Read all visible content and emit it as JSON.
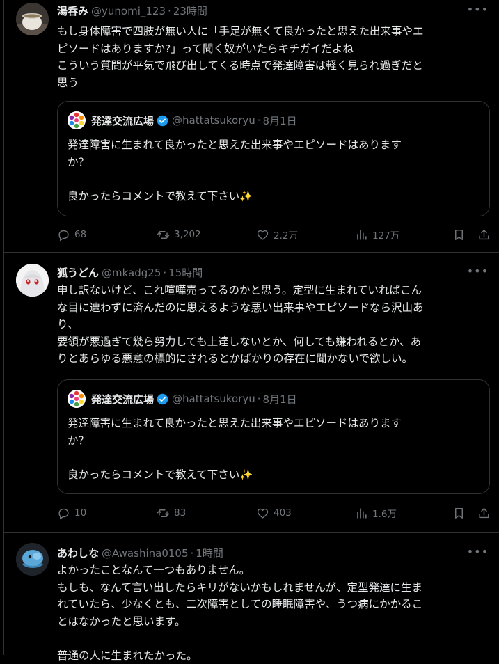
{
  "posts": [
    {
      "name": "湯呑み",
      "handle": "@yunomi_123",
      "time": "23時間",
      "lines": [
        "もし身体障害で四肢が無い人に「手足が無くて良かったと思えた出来事やエ",
        "ピソードはありますか?」って聞く奴がいたらキチガイだよね",
        "こういう質問が平気で飛び出してくる時点で発達障害は軽く見られ過ぎだと",
        "思う"
      ],
      "quote": {
        "name": "発達交流広場",
        "handle": "@hattatsukoryu",
        "time": "8月1日",
        "lines": [
          "発達障害に生まれて良かったと思えた出来事やエピソードはあります",
          "か？",
          "",
          "良かったらコメントで教えて下さい✨"
        ]
      },
      "stats": {
        "replies": "68",
        "reposts": "3,202",
        "likes": "2.2万",
        "views": "127万"
      }
    },
    {
      "name": "狐うどん",
      "handle": "@mkadg25",
      "time": "15時間",
      "lines": [
        "申し訳ないけど、これ喧嘩売ってるのかと思う。定型に生まれていればこん",
        "な目に遭わずに済んだのに思えるような悪い出来事やエピソードなら沢山あ",
        "り、",
        "要領が悪過ぎて幾ら努力しても上達しないとか、何しても嫌われるとか、あ",
        "りとあらゆる悪意の標的にされるとかばかりの存在に聞かないで欲しい。"
      ],
      "quote": {
        "name": "発達交流広場",
        "handle": "@hattatsukoryu",
        "time": "8月1日",
        "lines": [
          "発達障害に生まれて良かったと思えた出来事やエピソードはあります",
          "か？",
          "",
          "良かったらコメントで教えて下さい✨"
        ]
      },
      "stats": {
        "replies": "10",
        "reposts": "83",
        "likes": "403",
        "views": "1.6万"
      }
    },
    {
      "name": "あわしな",
      "handle": "@Awashina0105",
      "time": "1時間",
      "lines": [
        "よかったことなんて一つもありません。",
        "もしも、なんて言い出したらキリがないかもしれませんが、定型発達に生ま",
        "れていたら、少なくとも、二次障害としての睡眠障害や、うつ病にかかるこ",
        "とはなかったと思います。",
        "",
        "普通の人に生まれたかった。"
      ]
    }
  ],
  "icons": {
    "more": "more-icon",
    "reply": "reply-icon",
    "repost": "repost-icon",
    "like": "heart-icon",
    "views": "views-icon",
    "bookmark": "bookmark-icon",
    "share": "share-icon",
    "verified": "verified-badge-icon"
  },
  "colors": {
    "background": "#000000",
    "text": "#e7e9ea",
    "muted": "#71767b",
    "border": "#2f3336",
    "verified": "#1d9bf0"
  }
}
